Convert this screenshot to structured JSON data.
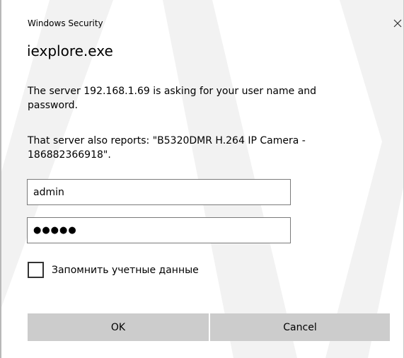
{
  "window": {
    "header": "Windows Security",
    "app_name": "iexplore.exe"
  },
  "message": {
    "server_prompt": "The server 192.168.1.69 is asking for your user name and password.",
    "server_report": "That server also reports: \"B5320DMR H.264 IP Camera - 186882366918\"."
  },
  "form": {
    "username_value": "admin",
    "password_masked": "●●●●●",
    "remember_label": "Запомнить учетные данные",
    "remember_checked": false
  },
  "buttons": {
    "ok_label": "OK",
    "cancel_label": "Cancel"
  },
  "icons": {
    "close": "close-icon"
  }
}
